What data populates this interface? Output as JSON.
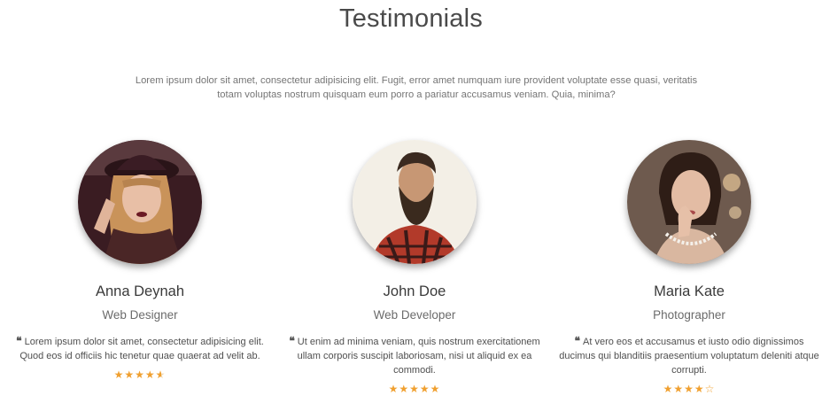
{
  "section": {
    "title": "Testimonials",
    "intro": "Lorem ipsum dolor sit amet, consectetur adipisicing elit. Fugit, error amet numquam iure provident voluptate esse quasi, veritatis totam voluptas nostrum quisquam eum porro a pariatur accusamus veniam. Quia, minima?"
  },
  "quote_icon": "quote-left-icon",
  "colors": {
    "star": "#f0a030",
    "heading": "#4a4a4a"
  },
  "testimonials": [
    {
      "name": "Anna Deynah",
      "role": "Web Designer",
      "quote": "Lorem ipsum dolor sit amet, consectetur adipisicing elit. Quod eos id officiis hic tenetur quae quaerat ad velit ab.",
      "rating": 4.5
    },
    {
      "name": "John Doe",
      "role": "Web Developer",
      "quote": "Ut enim ad minima veniam, quis nostrum exercitationem ullam corporis suscipit laboriosam, nisi ut aliquid ex ea commodi.",
      "rating": 5
    },
    {
      "name": "Maria Kate",
      "role": "Photographer",
      "quote": "At vero eos et accusamus et iusto odio dignissimos ducimus qui blanditiis praesentium voluptatum deleniti atque corrupti.",
      "rating": 4
    }
  ]
}
